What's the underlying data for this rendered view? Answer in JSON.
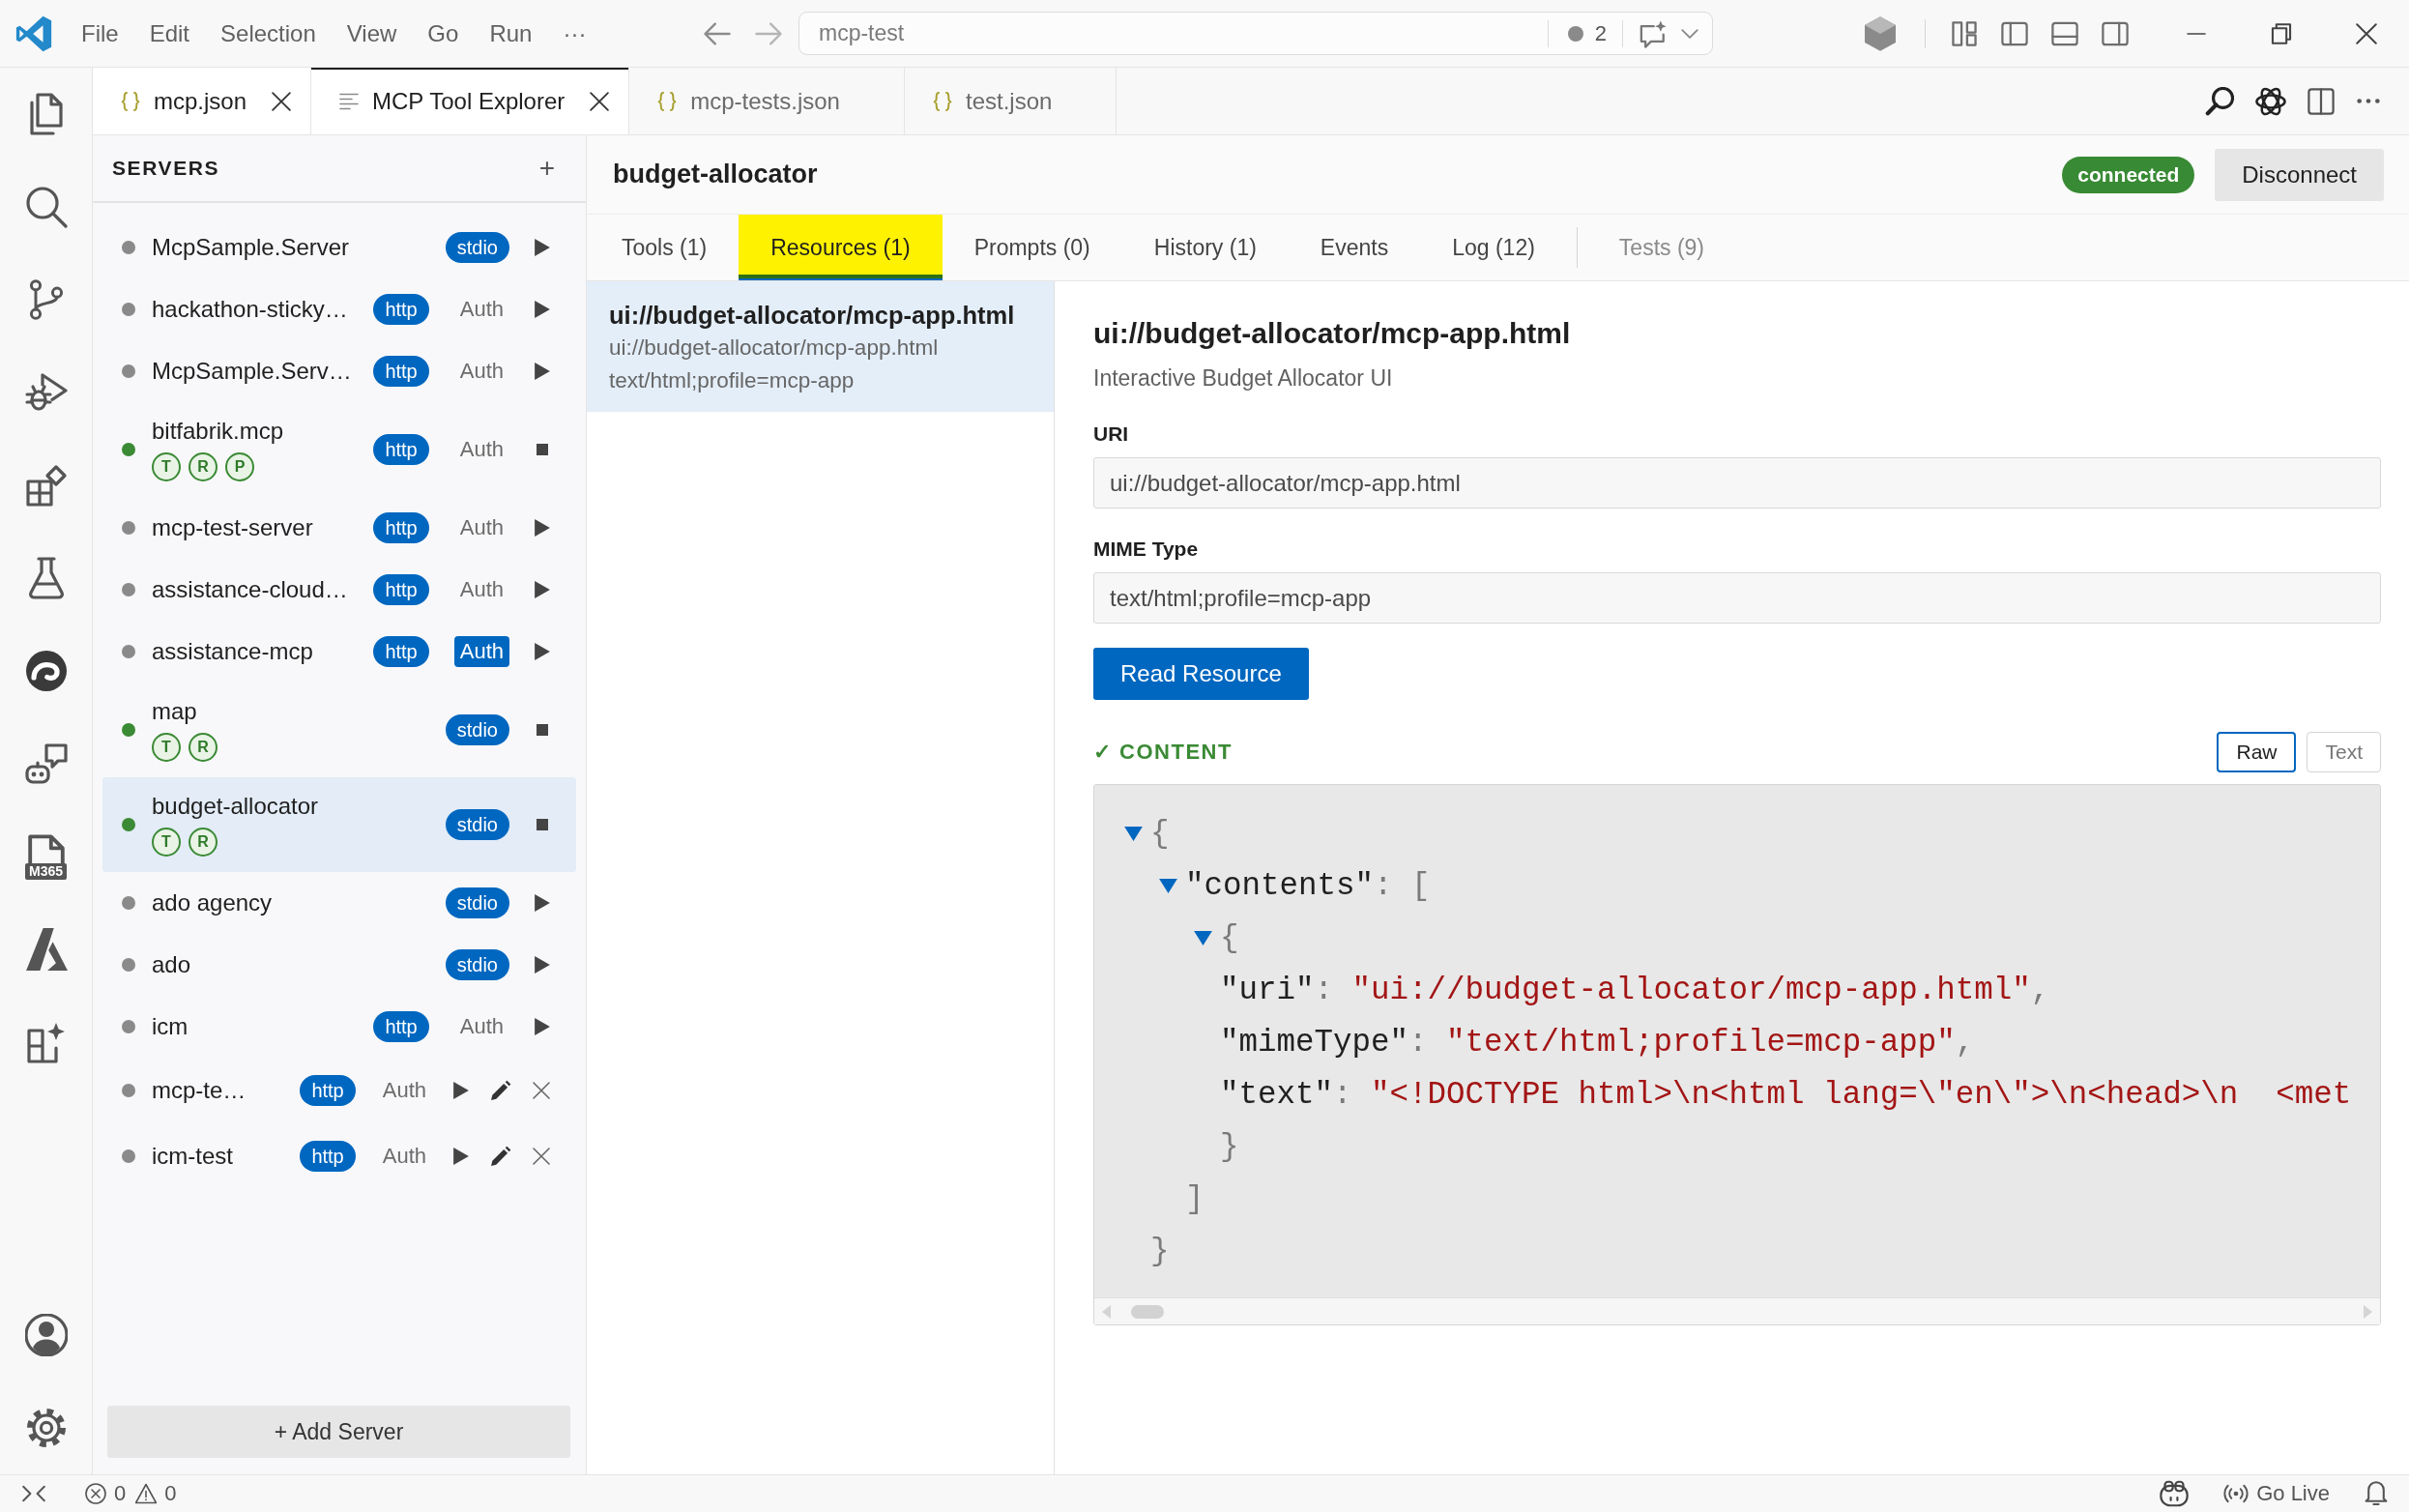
{
  "title_bar": {
    "menu": [
      "File",
      "Edit",
      "Selection",
      "View",
      "Go",
      "Run",
      "···"
    ],
    "search": {
      "value": "mcp-test"
    },
    "badge_count": "2"
  },
  "editor_tabs": [
    {
      "label": "mcp.json",
      "kind": "json",
      "selected": false,
      "hovered": true
    },
    {
      "label": "MCP Tool Explorer",
      "kind": "preview",
      "selected": true,
      "hovered": false
    },
    {
      "label": "mcp-tests.json",
      "kind": "json",
      "selected": false,
      "hovered": false
    },
    {
      "label": "test.json",
      "kind": "json",
      "selected": false,
      "hovered": false
    }
  ],
  "activity_bar": {
    "tile_label": "M365"
  },
  "sidebar": {
    "title": "SERVERS",
    "add": "+",
    "servers": [
      {
        "name": "McpSample.Server",
        "transport": "stdio",
        "connected": false,
        "selected": false,
        "editable": false
      },
      {
        "name": "hackathon-sticky…",
        "transport": "http",
        "auth": {
          "label": "Auth",
          "on": false
        },
        "connected": false,
        "selected": false,
        "editable": false
      },
      {
        "name": "McpSample.Serv…",
        "transport": "http",
        "auth": {
          "label": "Auth",
          "on": false
        },
        "connected": false,
        "selected": false,
        "editable": false
      },
      {
        "name": "bitfabrik.mcp",
        "capabilities": [
          "T",
          "R",
          "P"
        ],
        "transport": "http",
        "auth": {
          "label": "Auth",
          "on": false
        },
        "connected": true,
        "selected": false,
        "editable": false
      },
      {
        "name": "mcp-test-server",
        "transport": "http",
        "auth": {
          "label": "Auth",
          "on": false
        },
        "connected": false,
        "selected": false,
        "editable": false
      },
      {
        "name": "assistance-cloud…",
        "transport": "http",
        "auth": {
          "label": "Auth",
          "on": false
        },
        "connected": false,
        "selected": false,
        "editable": false
      },
      {
        "name": "assistance-mcp",
        "transport": "http",
        "auth": {
          "label": "Auth",
          "on": true
        },
        "connected": false,
        "selected": false,
        "editable": false
      },
      {
        "name": "map",
        "capabilities": [
          "T",
          "R"
        ],
        "transport": "stdio",
        "connected": true,
        "selected": false,
        "editable": false
      },
      {
        "name": "budget-allocator",
        "capabilities": [
          "T",
          "R"
        ],
        "transport": "stdio",
        "connected": true,
        "selected": true,
        "editable": false
      },
      {
        "name": "ado agency",
        "transport": "stdio",
        "connected": false,
        "selected": false,
        "editable": false
      },
      {
        "name": "ado",
        "transport": "stdio",
        "connected": false,
        "selected": false,
        "editable": false
      },
      {
        "name": "icm",
        "transport": "http",
        "auth": {
          "label": "Auth",
          "on": false
        },
        "connected": false,
        "selected": false,
        "editable": false
      },
      {
        "name": "mcp-te…",
        "transport": "http",
        "auth": {
          "label": "Auth",
          "on": false
        },
        "connected": false,
        "selected": false,
        "editable": true
      },
      {
        "name": "icm-test",
        "transport": "http",
        "auth": {
          "label": "Auth",
          "on": false
        },
        "connected": false,
        "selected": false,
        "editable": true
      }
    ],
    "add_server": "+ Add Server"
  },
  "panel": {
    "title": "budget-allocator",
    "status": {
      "label": "connected",
      "connected": true
    },
    "disconnect": "Disconnect",
    "tabs": [
      {
        "label": "Tools (1)",
        "kind": "view",
        "selected": false,
        "highlighted": false
      },
      {
        "label": "Resources (1)",
        "kind": "view",
        "selected": true,
        "highlighted": true
      },
      {
        "label": "Prompts (0)",
        "kind": "view",
        "selected": false,
        "highlighted": false
      },
      {
        "label": "History (1)",
        "kind": "view",
        "selected": false,
        "highlighted": false
      },
      {
        "label": "Events",
        "kind": "view",
        "selected": false,
        "highlighted": false
      },
      {
        "label": "Log (12)",
        "kind": "view",
        "selected": false,
        "highlighted": false
      },
      {
        "label": "Tests (9)",
        "kind": "extra",
        "selected": false,
        "highlighted": false
      }
    ],
    "resources": [
      {
        "name": "ui://budget-allocator/mcp-app.html",
        "uri": "ui://budget-allocator/mcp-app.html",
        "mime_type": "text/html;profile=mcp-app",
        "selected": true
      }
    ],
    "detail": {
      "title": "ui://budget-allocator/mcp-app.html",
      "description": "Interactive Budget Allocator UI",
      "fields": [
        {
          "label": "URI",
          "value": "ui://budget-allocator/mcp-app.html"
        },
        {
          "label": "MIME Type",
          "value": "text/html;profile=mcp-app"
        }
      ],
      "action": "Read Resource",
      "content": {
        "title": "✓ CONTENT",
        "views": [
          {
            "label": "Raw",
            "selected": true
          },
          {
            "label": "Text",
            "selected": false
          }
        ],
        "tree": {
          "open": "{",
          "close": "}",
          "expanded": true,
          "children": [
            {
              "key": "\"contents\"",
              "colon": ":",
              "open": "[",
              "close": "]",
              "expanded": true,
              "children": [
                {
                  "open": "{",
                  "close": "}",
                  "expanded": true,
                  "children": [
                    {
                      "key": "\"uri\"",
                      "colon": ":",
                      "value": "\"ui://budget-allocator/mcp-app.html\"",
                      "comma": ","
                    },
                    {
                      "key": "\"mimeType\"",
                      "colon": ":",
                      "value": "\"text/html;profile=mcp-app\"",
                      "comma": ","
                    },
                    {
                      "key": "\"text\"",
                      "colon": ":",
                      "value": "\"<!DOCTYPE html>\\n<html lang=\\\"en\\\">\\n<head>\\n  <met"
                    }
                  ]
                }
              ]
            }
          ]
        }
      }
    }
  },
  "status_bar": {
    "errors": "0",
    "warnings": "0",
    "live": "Go Live"
  }
}
